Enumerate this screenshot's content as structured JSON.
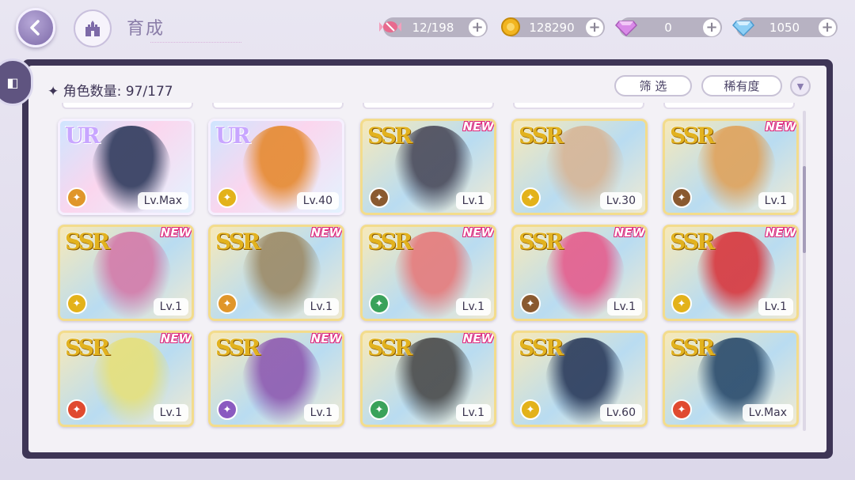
{
  "header": {
    "title": "育成"
  },
  "resources": [
    {
      "icon": "candy-icon",
      "value": "12/198",
      "color": "#e86a8e"
    },
    {
      "icon": "gold-coin-icon",
      "value": "128290",
      "color": "#f2b520"
    },
    {
      "icon": "pink-gem-icon",
      "value": "0",
      "color": "#d98ae8"
    },
    {
      "icon": "diamond-icon",
      "value": "1050",
      "color": "#8ecff5"
    }
  ],
  "panel": {
    "count_label": "角色数量: 97/177",
    "filter_label": "筛 选",
    "rarity_label": "稀有度"
  },
  "cards": [
    {
      "rarity": "UR",
      "level": "Lv.Max",
      "new": false,
      "elem_color": "#e0962a",
      "art_color": "#2e3a5c"
    },
    {
      "rarity": "UR",
      "level": "Lv.40",
      "new": false,
      "elem_color": "#e3b21a",
      "art_color": "#e5892f"
    },
    {
      "rarity": "SSR",
      "level": "Lv.1",
      "new": true,
      "elem_color": "#8a5a30",
      "art_color": "#4a4a5a"
    },
    {
      "rarity": "SSR",
      "level": "Lv.30",
      "new": false,
      "elem_color": "#e3b21a",
      "art_color": "#d7b596"
    },
    {
      "rarity": "SSR",
      "level": "Lv.1",
      "new": true,
      "elem_color": "#8a5a30",
      "art_color": "#e0a25a"
    },
    {
      "rarity": "SSR",
      "level": "Lv.1",
      "new": true,
      "elem_color": "#e3b21a",
      "art_color": "#d47aa8"
    },
    {
      "rarity": "SSR",
      "level": "Lv.1",
      "new": true,
      "elem_color": "#e0962a",
      "art_color": "#9c8a66"
    },
    {
      "rarity": "SSR",
      "level": "Lv.1",
      "new": true,
      "elem_color": "#3aa25a",
      "art_color": "#e67a7a"
    },
    {
      "rarity": "SSR",
      "level": "Lv.1",
      "new": true,
      "elem_color": "#8a5a30",
      "art_color": "#e55c8c"
    },
    {
      "rarity": "SSR",
      "level": "Lv.1",
      "new": true,
      "elem_color": "#e3b21a",
      "art_color": "#d8363c"
    },
    {
      "rarity": "SSR",
      "level": "Lv.1",
      "new": true,
      "elem_color": "#e04a30",
      "art_color": "#e6e07a"
    },
    {
      "rarity": "SSR",
      "level": "Lv.1",
      "new": true,
      "elem_color": "#8a5ac0",
      "art_color": "#8e5ab0"
    },
    {
      "rarity": "SSR",
      "level": "Lv.1",
      "new": true,
      "elem_color": "#3aa25a",
      "art_color": "#4a4a4a"
    },
    {
      "rarity": "SSR",
      "level": "Lv.60",
      "new": false,
      "elem_color": "#e3b21a",
      "art_color": "#2a3a5a"
    },
    {
      "rarity": "SSR",
      "level": "Lv.Max",
      "new": false,
      "elem_color": "#e04a30",
      "art_color": "#2a4a6a"
    }
  ]
}
